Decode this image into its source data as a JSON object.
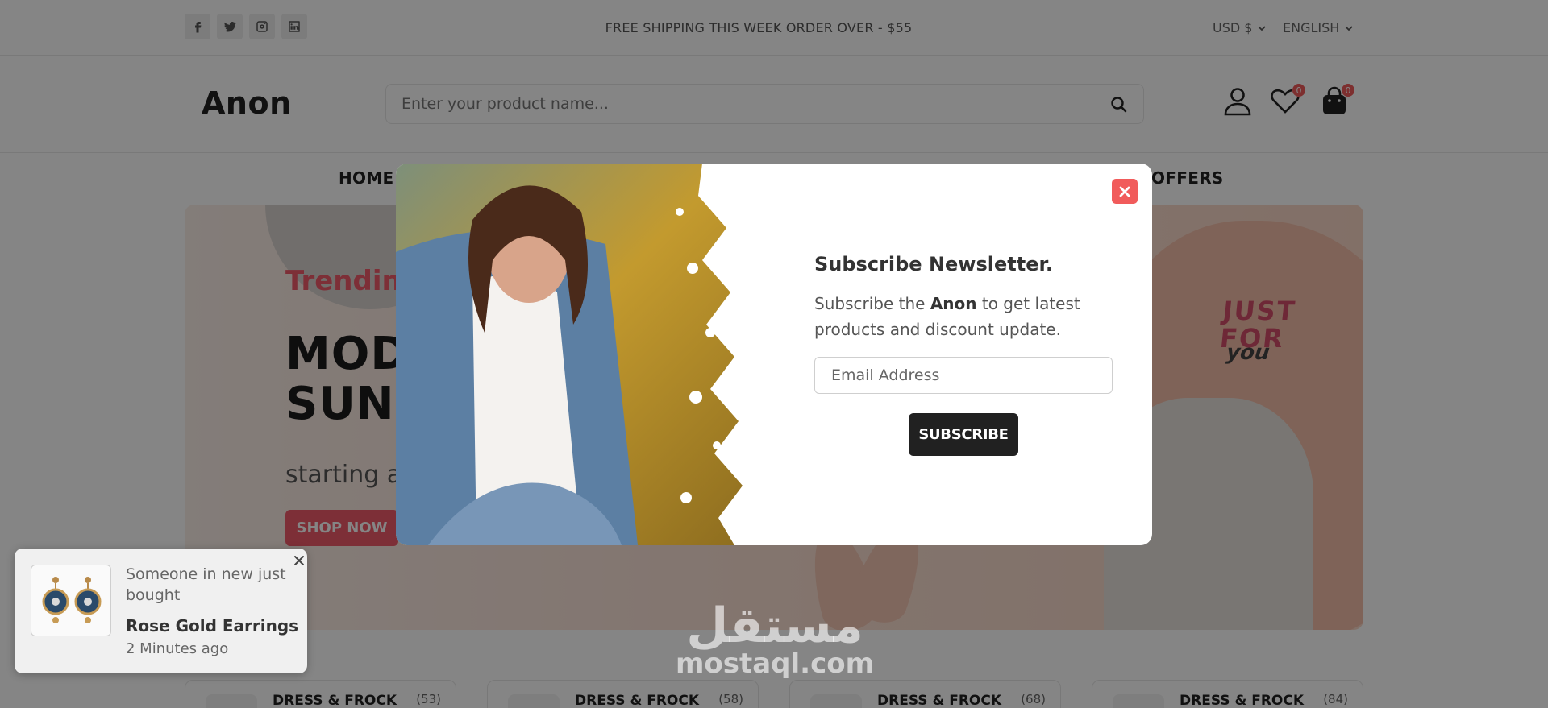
{
  "topbar": {
    "social": [
      "facebook-icon",
      "twitter-icon",
      "instagram-icon",
      "linkedin-icon"
    ],
    "promo": "FREE SHIPPING THIS WEEK ORDER OVER - $55",
    "currency": "USD $",
    "language": "ENGLISH"
  },
  "header": {
    "logo": "Anon",
    "search_placeholder": "Enter your product name...",
    "wishlist_count": "0",
    "cart_count": "0"
  },
  "nav": {
    "home": "HOME",
    "offers": "OFFERS"
  },
  "hero": {
    "subtitle": "Trending",
    "title_line1": "MODERN",
    "title_line2": "SUNGLASSES",
    "starting": "starting at",
    "button": "SHOP NOW",
    "badge_line1": "JUST",
    "badge_line2": "FOR",
    "badge_line3": "you"
  },
  "categories": [
    {
      "name": "DRESS & FROCK",
      "count": "(53)"
    },
    {
      "name": "DRESS & FROCK",
      "count": "(58)"
    },
    {
      "name": "DRESS & FROCK",
      "count": "(68)"
    },
    {
      "name": "DRESS & FROCK",
      "count": "(84)"
    }
  ],
  "modal": {
    "title": "Subscribe Newsletter.",
    "desc_before": "Subscribe the ",
    "desc_brand": "Anon",
    "desc_after": " to get latest products and discount update.",
    "email_placeholder": "Email Address",
    "button": "SUBSCRIBE"
  },
  "toast": {
    "message": "Someone in new just bought",
    "product": "Rose Gold Earrings",
    "time": "2 Minutes ago"
  },
  "watermark": {
    "arabic": "مستقل",
    "latin": "mostaql.com"
  },
  "colors": {
    "accent": "#f05a6a",
    "close": "#f15b5b",
    "dark": "#212121",
    "overlay": "rgba(0,0,0,0.48)"
  }
}
